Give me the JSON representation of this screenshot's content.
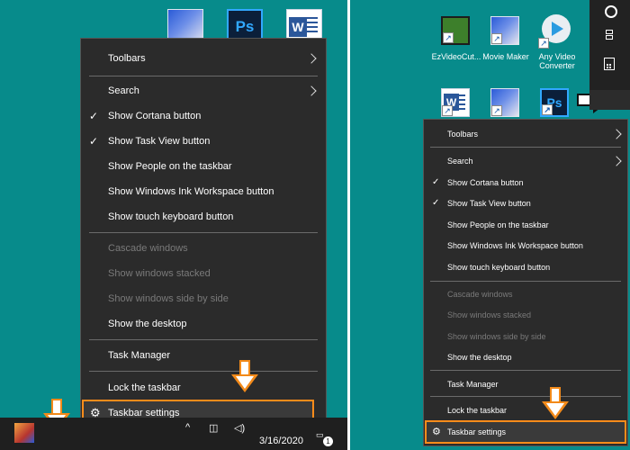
{
  "left": {
    "menu": {
      "items": [
        {
          "label": "Toolbars",
          "submenu": true
        },
        {
          "label": "Search",
          "submenu": true
        },
        {
          "label": "Show Cortana button",
          "checked": true
        },
        {
          "label": "Show Task View button",
          "checked": true
        },
        {
          "label": "Show People on the taskbar"
        },
        {
          "label": "Show Windows Ink Workspace button"
        },
        {
          "label": "Show touch keyboard button"
        },
        {
          "label": "Cascade windows",
          "disabled": true
        },
        {
          "label": "Show windows stacked",
          "disabled": true
        },
        {
          "label": "Show windows side by side",
          "disabled": true
        },
        {
          "label": "Show the desktop"
        },
        {
          "label": "Task Manager"
        },
        {
          "label": "Lock the taskbar"
        },
        {
          "label": "Taskbar settings",
          "icon": "gear-icon",
          "highlighted": true
        }
      ]
    },
    "desktop_icons": [
      {
        "name": "feather-app-icon"
      },
      {
        "name": "photoshop-icon",
        "glyph": "Ps"
      },
      {
        "name": "word-icon",
        "glyph": "W"
      }
    ],
    "taskbar": {
      "date": "3/16/2020",
      "notification_count": "1"
    }
  },
  "right": {
    "desktop_icons": [
      {
        "label": "EzVideoCut...",
        "icon": "film-icon"
      },
      {
        "label": "Movie Maker",
        "icon": "feather-app-icon"
      },
      {
        "label": "Any Video Converter",
        "icon": "video-converter-icon"
      },
      {
        "label": "",
        "icon": "word-icon",
        "glyph": "W"
      },
      {
        "label": "",
        "icon": "feather-app-icon"
      },
      {
        "label": "",
        "icon": "photoshop-icon",
        "glyph": "Ps"
      }
    ],
    "menu": {
      "items": [
        {
          "label": "Toolbars",
          "submenu": true
        },
        {
          "label": "Search",
          "submenu": true
        },
        {
          "label": "Show Cortana button",
          "checked": true
        },
        {
          "label": "Show Task View button",
          "checked": true
        },
        {
          "label": "Show People on the taskbar"
        },
        {
          "label": "Show Windows Ink Workspace button"
        },
        {
          "label": "Show touch keyboard button"
        },
        {
          "label": "Cascade windows",
          "disabled": true
        },
        {
          "label": "Show windows stacked",
          "disabled": true
        },
        {
          "label": "Show windows side by side",
          "disabled": true
        },
        {
          "label": "Show the desktop"
        },
        {
          "label": "Task Manager"
        },
        {
          "label": "Lock the taskbar"
        },
        {
          "label": "Taskbar settings",
          "icon": "gear-icon",
          "highlighted": true
        }
      ]
    },
    "action_strip": [
      "cortana-circle-icon",
      "task-view-icon",
      "calculator-icon"
    ]
  },
  "colors": {
    "desktop": "#078b8b",
    "menu_bg": "#2b2b2b",
    "menu_text": "#ffffff",
    "disabled_text": "#7a7a7a",
    "highlight_border": "#ff8c1a",
    "arrow_accent": "#f28a1a",
    "taskbar": "#1f1f1f"
  }
}
